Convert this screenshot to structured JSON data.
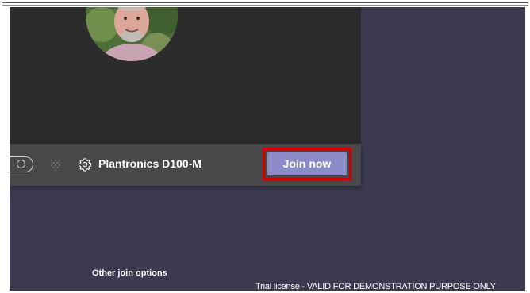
{
  "preview": {
    "avatar_icon": "user-photo"
  },
  "controls": {
    "video_toggle_icon": "toggle-switch-icon",
    "background_effects_icon": "blur-icon",
    "device_settings_icon": "gear-icon",
    "device_name": "Plantronics D100-M",
    "join_label": "Join now",
    "highlight_color": "#d00000",
    "join_color": "#8b8cc7"
  },
  "footer": {
    "other_join_options": "Other join options",
    "watermark": "Trial license - VALID FOR DEMONSTRATION PURPOSE ONLY"
  },
  "colors": {
    "app_background": "#3b3a50",
    "preview_background": "#2d2c2c",
    "controls_background": "#48474a"
  }
}
